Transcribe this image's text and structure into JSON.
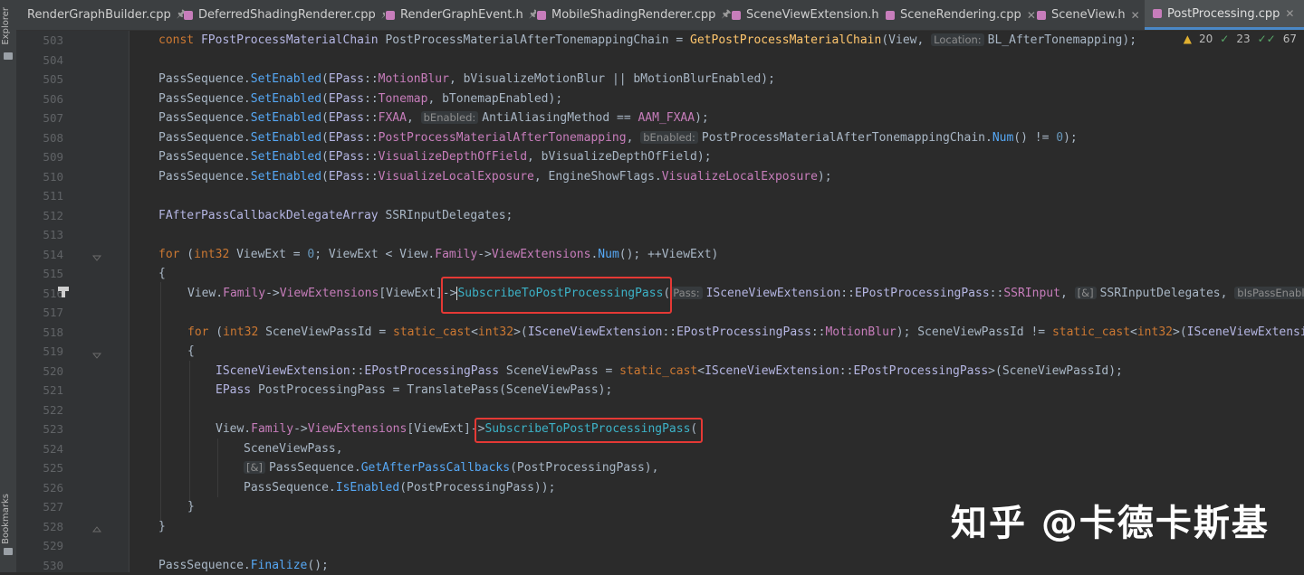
{
  "sidebar": {
    "top_label": "Explorer",
    "bottom_label": "Bookmarks"
  },
  "tabs": [
    {
      "name": "RenderGraphBuilder.cpp",
      "trail": "pin"
    },
    {
      "name": "DeferredShadingRenderer.cpp",
      "trail": "pin"
    },
    {
      "name": "RenderGraphEvent.h",
      "trail": "pin"
    },
    {
      "name": "MobileShadingRenderer.cpp",
      "trail": "pin"
    },
    {
      "name": "SceneViewExtension.h",
      "trail": "close"
    },
    {
      "name": "SceneRendering.cpp",
      "trail": "close"
    },
    {
      "name": "SceneView.h",
      "trail": "close"
    },
    {
      "name": "PostProcessing.cpp",
      "trail": "close",
      "active": true
    }
  ],
  "inspections": {
    "warnings": "20",
    "weak_warnings": "23",
    "typos": "67"
  },
  "hints": {
    "location": "Location:",
    "benabled": "bEnabled:",
    "pass": "Pass:",
    "amp": "[&]",
    "bispass": "bIsPassEnabled"
  },
  "line_numbers": [
    "503",
    "504",
    "505",
    "506",
    "507",
    "508",
    "509",
    "510",
    "511",
    "512",
    "513",
    "514",
    "515",
    "516",
    "517",
    "518",
    "519",
    "520",
    "521",
    "522",
    "523",
    "524",
    "525",
    "526",
    "527",
    "528",
    "529",
    "530"
  ],
  "code": {
    "l503": {
      "a": "const ",
      "b": "FPostProcessMaterialChain",
      "c": " PostProcessMaterialAfterTonemappingChain = ",
      "d": "GetPostProcessMaterialChain",
      "e": "(View, ",
      "f": "BL_AfterTonemapping);"
    },
    "l505": {
      "a": "PassSequence.",
      "b": "SetEnabled",
      "c": "(",
      "d": "EPass",
      "e": "::",
      "f": "MotionBlur",
      "g": ", bVisualizeMotionBlur || bMotionBlurEnabled);"
    },
    "l506": {
      "a": "PassSequence.",
      "b": "SetEnabled",
      "c": "(",
      "d": "EPass",
      "e": "::",
      "f": "Tonemap",
      "g": ", bTonemapEnabled);"
    },
    "l507": {
      "a": "PassSequence.",
      "b": "SetEnabled",
      "c": "(",
      "d": "EPass",
      "e": "::",
      "f": "FXAA",
      "g": ", ",
      "h": "AntiAliasingMethod == ",
      "i": "AAM_FXAA",
      "j": ");"
    },
    "l508": {
      "a": "PassSequence.",
      "b": "SetEnabled",
      "c": "(",
      "d": "EPass",
      "e": "::",
      "f": "PostProcessMaterialAfterTonemapping",
      "g": ", ",
      "h": "PostProcessMaterialAfterTonemappingChain.",
      "i": "Num",
      "j": "() != ",
      "k": "0",
      "l": ");"
    },
    "l509": {
      "a": "PassSequence.",
      "b": "SetEnabled",
      "c": "(",
      "d": "EPass",
      "e": "::",
      "f": "VisualizeDepthOfField",
      "g": ", bVisualizeDepthOfField);"
    },
    "l510": {
      "a": "PassSequence.",
      "b": "SetEnabled",
      "c": "(",
      "d": "EPass",
      "e": "::",
      "f": "VisualizeLocalExposure",
      "g": ", EngineShowFlags.",
      "h": "VisualizeLocalExposure",
      "i": ");"
    },
    "l512": {
      "a": "FAfterPassCallbackDelegateArray",
      "b": " SSRInputDelegates;"
    },
    "l514": {
      "a": "for",
      "b": " (",
      "c": "int32",
      "d": " ViewExt = ",
      "e": "0",
      "f": "; ViewExt < View.",
      "g": "Family",
      "h": "->",
      "i": "ViewExtensions",
      "j": ".",
      "k": "Num",
      "l": "(); ++ViewExt)"
    },
    "l515": {
      "a": "{"
    },
    "l516": {
      "a": "View.",
      "b": "Family",
      "c": "->",
      "d": "ViewExtensions",
      "e": "[ViewExt]->",
      "f": "SubscribeToPostProcessingPass",
      "g": "(",
      "h": "ISceneViewExtension",
      "i": "::",
      "j": "EPostProcessingPass",
      "k": "::",
      "l": "SSRInput",
      "m": ", ",
      "n": "SSRInputDelegates, "
    },
    "l518": {
      "a": "for",
      "b": " (",
      "c": "int32",
      "d": " SceneViewPassId = ",
      "e": "static_cast",
      "f": "<",
      "g": "int32",
      "h": ">(",
      "i": "ISceneViewExtension",
      "j": "::",
      "k": "EPostProcessingPass",
      "l": "::",
      "m": "MotionBlur",
      "n": "); SceneViewPassId != ",
      "o": "static_cast",
      "p": "<",
      "q": "int32",
      "r": ">(",
      "s": "ISceneViewExtensi"
    },
    "l519": {
      "a": "{"
    },
    "l520": {
      "a": "ISceneViewExtension",
      "b": "::",
      "c": "EPostProcessingPass",
      "d": " SceneViewPass = ",
      "e": "static_cast",
      "f": "<",
      "g": "ISceneViewExtension",
      "h": "::",
      "i": "EPostProcessingPass",
      "j": ">(SceneViewPassId);"
    },
    "l521": {
      "a": "EPass",
      "b": " PostProcessingPass = TranslatePass(SceneViewPass);"
    },
    "l523": {
      "a": "View.",
      "b": "Family",
      "c": "->",
      "d": "ViewExtensions",
      "e": "[ViewExt]->",
      "f": "SubscribeToPostProcessingPass",
      "g": "("
    },
    "l524": {
      "a": "SceneViewPass,"
    },
    "l525": {
      "a": "PassSequence.",
      "b": "GetAfterPassCallbacks",
      "c": "(PostProcessingPass),"
    },
    "l526": {
      "a": "PassSequence.",
      "b": "IsEnabled",
      "c": "(PostProcessingPass));"
    },
    "l527": {
      "a": "}"
    },
    "l528": {
      "a": "}"
    },
    "l530": {
      "a": "PassSequence.",
      "b": "Finalize",
      "c": "();"
    }
  },
  "watermark": "知乎 @卡德卡斯基",
  "colors": {
    "highlight_box": "#e53935",
    "tab_active_underline": "#4a88c7"
  }
}
